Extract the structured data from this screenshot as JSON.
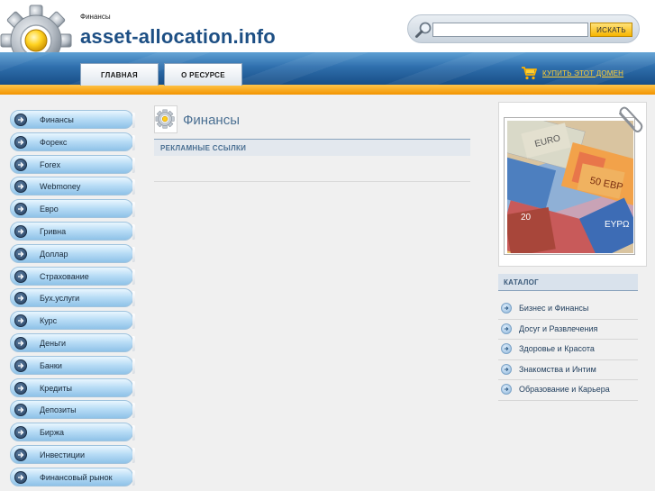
{
  "header": {
    "breadcrumb": "Финансы",
    "site_title": "asset-allocation.info",
    "search": {
      "placeholder": "",
      "button_label": "ИСКАТЬ"
    },
    "nav": [
      {
        "label": "ГЛАВНАЯ"
      },
      {
        "label": "О РЕСУРСЕ"
      }
    ],
    "buy_link": "КУПИТЬ ЭТОТ ДОМЕН"
  },
  "sidebar": {
    "items": [
      {
        "label": "Финансы"
      },
      {
        "label": "Форекс"
      },
      {
        "label": "Forex"
      },
      {
        "label": "Webmoney"
      },
      {
        "label": "Евро"
      },
      {
        "label": "Гривна"
      },
      {
        "label": "Доллар"
      },
      {
        "label": "Страхование"
      },
      {
        "label": "Бух.услуги"
      },
      {
        "label": "Курс"
      },
      {
        "label": "Деньги"
      },
      {
        "label": "Банки"
      },
      {
        "label": "Кредиты"
      },
      {
        "label": "Депозиты"
      },
      {
        "label": "Биржа"
      },
      {
        "label": "Инвестиции"
      },
      {
        "label": "Финансовый рынок"
      }
    ]
  },
  "content": {
    "title": "Финансы",
    "ads_label": "РЕКЛАМНЫЕ ССЫЛКИ"
  },
  "catalog": {
    "title": "КАТАЛОГ",
    "items": [
      {
        "label": "Бизнес и Финансы"
      },
      {
        "label": "Досуг и Развлечения"
      },
      {
        "label": "Здоровье и Красота"
      },
      {
        "label": "Знакомства и Интим"
      },
      {
        "label": "Образование и Карьера"
      }
    ]
  },
  "colors": {
    "brand_blue": "#1d4f84",
    "accent_orange": "#f29400",
    "button_yellow": "#f7b500"
  }
}
